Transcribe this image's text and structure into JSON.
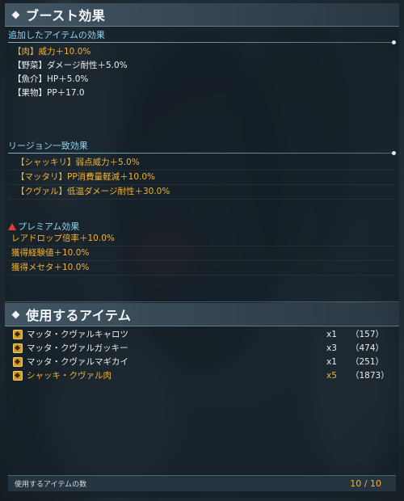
{
  "boost_panel": {
    "title": "ブースト効果",
    "added_items": {
      "title": "追加したアイテムの効果",
      "rows": [
        {
          "text": "【肉】威力＋10.0%",
          "highlight": true
        },
        {
          "text": "【野菜】ダメージ耐性＋5.0%",
          "highlight": false
        },
        {
          "text": "【魚介】HP＋5.0%",
          "highlight": false
        },
        {
          "text": "【果物】PP＋17.0",
          "highlight": false
        }
      ]
    },
    "region_match": {
      "title": "リージョン一致効果",
      "rows": [
        {
          "text": "【シャッキリ】弱点威力＋5.0%",
          "highlight": true
        },
        {
          "text": "【マッタリ】PP消費量軽減＋10.0%",
          "highlight": true
        },
        {
          "text": "【クヴァル】低温ダメージ耐性＋30.0%",
          "highlight": true
        }
      ]
    },
    "premium": {
      "title": "プレミアム効果",
      "icon": "warning-triangle-icon",
      "rows": [
        {
          "text": "レアドロップ倍率＋10.0%",
          "highlight": true
        },
        {
          "text": "獲得経験値＋10.0%",
          "highlight": true
        },
        {
          "text": "獲得メセタ＋10.0%",
          "highlight": true
        }
      ]
    }
  },
  "items_panel": {
    "title": "使用するアイテム",
    "items": [
      {
        "name": "マッタ・クヴァルキャロツ",
        "qty": "x1",
        "stock": "（157）",
        "highlight": false,
        "icon": "vegetable-icon"
      },
      {
        "name": "マッタ・クヴァルガッキー",
        "qty": "x3",
        "stock": "（474）",
        "highlight": false,
        "icon": "fruit-icon"
      },
      {
        "name": "マッタ・クヴァルマギカイ",
        "qty": "x1",
        "stock": "（251）",
        "highlight": false,
        "icon": "seafood-icon"
      },
      {
        "name": "シャッキ・クヴァル肉",
        "qty": "x5",
        "stock": "（1873）",
        "highlight": true,
        "icon": "meat-icon"
      }
    ],
    "footer": {
      "label": "使用するアイテムの数",
      "count": "10 / 10"
    }
  },
  "colors": {
    "accent_orange": "#f2b233",
    "section_blue": "#8fd3f0",
    "text_white": "#e9eef1",
    "warning_red": "#e23b3b"
  }
}
